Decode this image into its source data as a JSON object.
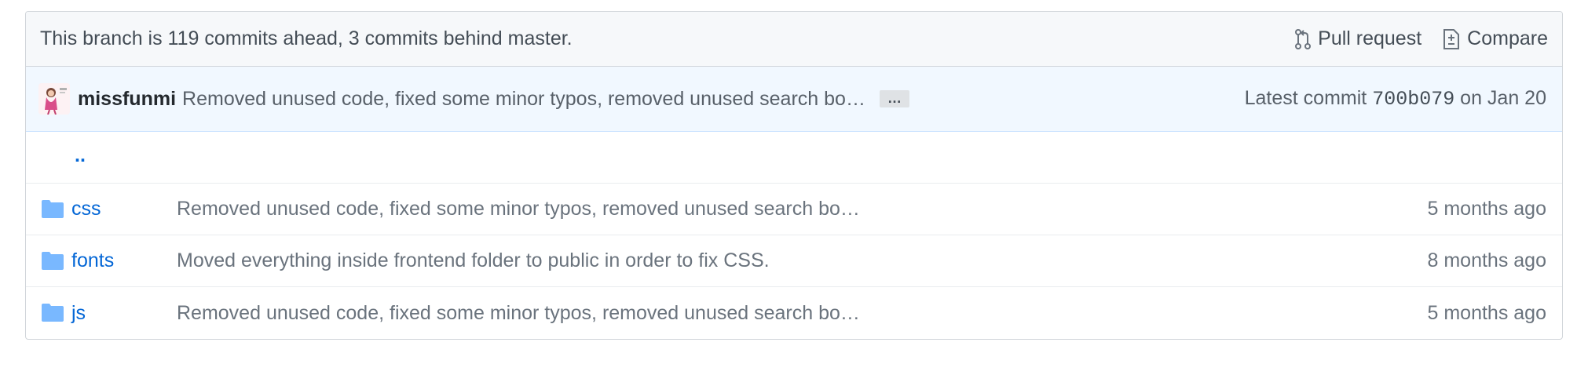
{
  "branch_bar": {
    "status_text": "This branch is 119 commits ahead, 3 commits behind master.",
    "pull_request_label": "Pull request",
    "compare_label": "Compare"
  },
  "latest_commit": {
    "author": "missfunmi",
    "message": "Removed unused code, fixed some minor typos, removed unused search bo…",
    "ellipsis": "…",
    "latest_prefix": "Latest commit",
    "sha": "700b079",
    "date_text": "on Jan 20"
  },
  "parent_dir": {
    "label": ".."
  },
  "files": [
    {
      "name": "css",
      "type": "folder",
      "message": "Removed unused code, fixed some minor typos, removed unused search bo…",
      "age": "5 months ago"
    },
    {
      "name": "fonts",
      "type": "folder",
      "message": "Moved everything inside frontend folder to public in order to fix CSS.",
      "age": "8 months ago"
    },
    {
      "name": "js",
      "type": "folder",
      "message": "Removed unused code, fixed some minor typos, removed unused search bo…",
      "age": "5 months ago"
    }
  ],
  "icons": {
    "pull_request": "git-pull-request-icon",
    "compare": "diff-icon",
    "folder": "folder-icon"
  },
  "colors": {
    "link": "#0366d6",
    "folder": "#79b8ff",
    "commit_bar_bg": "#f1f8ff",
    "branch_bar_bg": "#f6f8fa",
    "muted_text": "#6a737d"
  }
}
